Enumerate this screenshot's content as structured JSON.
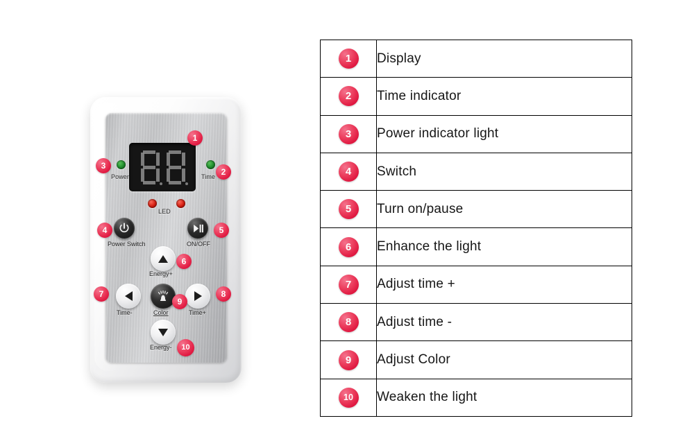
{
  "legend": {
    "rows": [
      {
        "number": "1",
        "label": "Display"
      },
      {
        "number": "2",
        "label": "Time indicator"
      },
      {
        "number": "3",
        "label": "Power indicator light"
      },
      {
        "number": "4",
        "label": "Switch"
      },
      {
        "number": "5",
        "label": "Turn on/pause"
      },
      {
        "number": "6",
        "label": "Enhance the light"
      },
      {
        "number": "7",
        "label": "Adjust time +"
      },
      {
        "number": "8",
        "label": "Adjust time  -"
      },
      {
        "number": "9",
        "label": "Adjust Color"
      },
      {
        "number": "10",
        "label": "Weaken the light"
      }
    ]
  },
  "device": {
    "panel_labels": {
      "power": "Power",
      "time": "Time",
      "led": "LED"
    },
    "buttons": [
      {
        "id": "power-switch",
        "caption": "Power Switch",
        "icon": "power-icon",
        "badge": "4"
      },
      {
        "id": "onoff",
        "caption": "ON/OFF",
        "icon": "play-pause-icon",
        "badge": "5"
      },
      {
        "id": "energy-plus",
        "caption": "Energy+",
        "icon": "arrow-up-icon",
        "badge": "6"
      },
      {
        "id": "time-minus",
        "caption": "Time-",
        "icon": "arrow-left-icon",
        "badge": "7"
      },
      {
        "id": "color",
        "caption": "Color",
        "icon": "lamp-icon",
        "badge": "9"
      },
      {
        "id": "time-plus",
        "caption": "Time+",
        "icon": "arrow-right-icon",
        "badge": "8"
      },
      {
        "id": "energy-minus",
        "caption": "Energy-",
        "icon": "arrow-down-icon",
        "badge": "10"
      }
    ],
    "indicators": [
      {
        "id": "power-lamp",
        "color": "#1f8c2c",
        "badge": "3"
      },
      {
        "id": "time-lamp",
        "color": "#1f8c2c",
        "badge": "2"
      },
      {
        "id": "led-lamp-1",
        "color": "#d51d10"
      },
      {
        "id": "led-lamp-2",
        "color": "#d51d10"
      }
    ],
    "display": {
      "badge": "1",
      "digits": [
        "8.",
        "8."
      ],
      "segment_color": "#8e8e8e",
      "screen_color": "#151515"
    }
  },
  "colors": {
    "badge_red": "#e01a42",
    "badge_red_light": "#f4728c",
    "table_border": "#000000",
    "background": "#ffffff",
    "panel_silver": "#c6c7c9",
    "body_white": "#f2f2f2"
  }
}
